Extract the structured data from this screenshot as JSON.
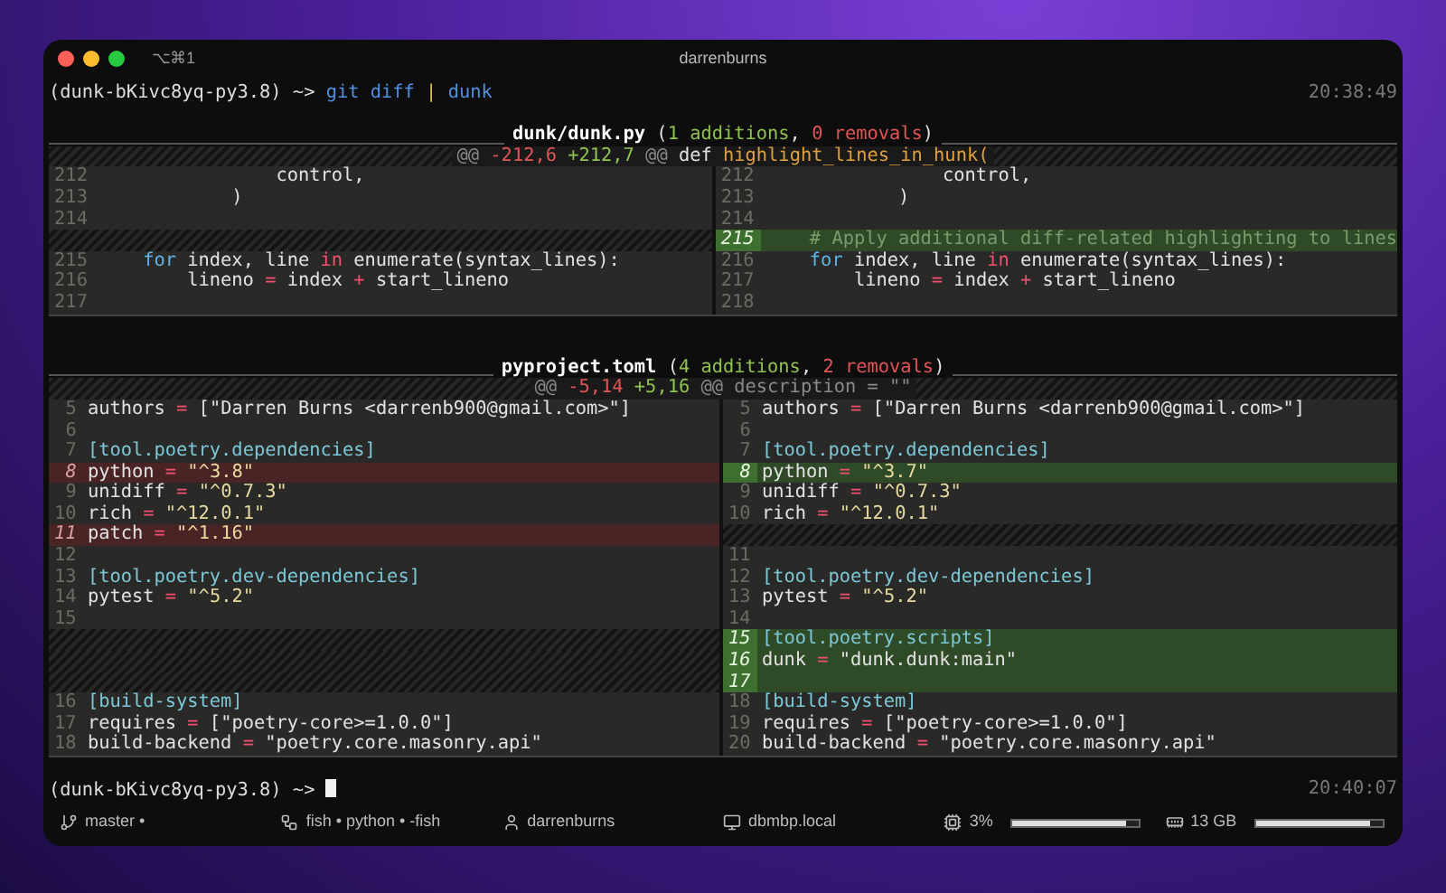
{
  "window": {
    "shortcut": "⌥⌘1",
    "title": "darrenburns"
  },
  "prompt_1": {
    "env": "(dunk-bKivc8yq-py3.8) ~> ",
    "command": [
      {
        "t": "git diff",
        "kind": "cmd"
      },
      {
        "t": " | ",
        "kind": "pipe"
      },
      {
        "t": "dunk",
        "kind": "cmd"
      }
    ],
    "time": "20:38:49"
  },
  "diffs": [
    {
      "header": [
        {
          "t": "dunk/dunk.py",
          "kind": "file"
        },
        {
          "t": " (",
          "kind": "p"
        },
        {
          "t": "1 additions",
          "kind": "add"
        },
        {
          "t": ", ",
          "kind": "p"
        },
        {
          "t": "0 removals",
          "kind": "del"
        },
        {
          "t": ")",
          "kind": "p"
        }
      ],
      "hunk": [
        {
          "t": "@@ ",
          "kind": "dim"
        },
        {
          "t": "-212,6 ",
          "kind": "del"
        },
        {
          "t": "+212,7",
          "kind": "add"
        },
        {
          "t": " @@ ",
          "kind": "dim"
        },
        {
          "t": "def ",
          "kind": "p"
        },
        {
          "t": "highlight_lines_in_hunk(",
          "kind": "fn"
        }
      ],
      "rows": [
        {
          "left": {
            "kind": "context",
            "num": "212",
            "code": [
              {
                "t": "                control,",
                "kind": "p"
              }
            ]
          },
          "right": {
            "kind": "context",
            "num": "212",
            "code": [
              {
                "t": "                control,",
                "kind": "p"
              }
            ]
          }
        },
        {
          "left": {
            "kind": "context",
            "num": "213",
            "code": [
              {
                "t": "            )",
                "kind": "p"
              }
            ]
          },
          "right": {
            "kind": "context",
            "num": "213",
            "code": [
              {
                "t": "            )",
                "kind": "p"
              }
            ]
          }
        },
        {
          "left": {
            "kind": "context",
            "num": "214"
          },
          "right": {
            "kind": "context",
            "num": "214"
          }
        },
        {
          "left": {
            "kind": "filler"
          },
          "right": {
            "kind": "added",
            "num": "215",
            "code": [
              {
                "t": "    # Apply additional diff-related highlighting to lines",
                "kind": "comment"
              }
            ]
          }
        },
        {
          "left": {
            "kind": "context",
            "num": "215",
            "code": [
              {
                "t": "    for",
                "kind": "kw"
              },
              {
                "t": " index, line ",
                "kind": "p"
              },
              {
                "t": "in",
                "kind": "op"
              },
              {
                "t": " enumerate(syntax_lines):",
                "kind": "p"
              }
            ]
          },
          "right": {
            "kind": "context",
            "num": "216",
            "code": [
              {
                "t": "    for",
                "kind": "kw"
              },
              {
                "t": " index, line ",
                "kind": "p"
              },
              {
                "t": "in",
                "kind": "op"
              },
              {
                "t": " enumerate(syntax_lines):",
                "kind": "p"
              }
            ]
          }
        },
        {
          "left": {
            "kind": "context",
            "num": "216",
            "code": [
              {
                "t": "        lineno ",
                "kind": "p"
              },
              {
                "t": "=",
                "kind": "op"
              },
              {
                "t": " index ",
                "kind": "p"
              },
              {
                "t": "+",
                "kind": "op"
              },
              {
                "t": " start_lineno",
                "kind": "p"
              }
            ]
          },
          "right": {
            "kind": "context",
            "num": "217",
            "code": [
              {
                "t": "        lineno ",
                "kind": "p"
              },
              {
                "t": "=",
                "kind": "op"
              },
              {
                "t": " index ",
                "kind": "p"
              },
              {
                "t": "+",
                "kind": "op"
              },
              {
                "t": " start_lineno",
                "kind": "p"
              }
            ]
          }
        },
        {
          "left": {
            "kind": "context",
            "num": "217"
          },
          "right": {
            "kind": "context",
            "num": "218"
          }
        }
      ]
    },
    {
      "header": [
        {
          "t": "pyproject.toml",
          "kind": "file"
        },
        {
          "t": " (",
          "kind": "p"
        },
        {
          "t": "4 additions",
          "kind": "add"
        },
        {
          "t": ", ",
          "kind": "p"
        },
        {
          "t": "2 removals",
          "kind": "del"
        },
        {
          "t": ")",
          "kind": "p"
        }
      ],
      "hunk": [
        {
          "t": "@@ ",
          "kind": "dim"
        },
        {
          "t": "-5,14 ",
          "kind": "del"
        },
        {
          "t": "+5,16",
          "kind": "add"
        },
        {
          "t": " @@ ",
          "kind": "dim"
        },
        {
          "t": "description = \"\"",
          "kind": "dim"
        }
      ],
      "rows": [
        {
          "left": {
            "kind": "context",
            "num": "5",
            "code": [
              {
                "t": "authors ",
                "kind": "p"
              },
              {
                "t": "=",
                "kind": "op"
              },
              {
                "t": " [\"Darren Burns <darrenb900@gmail.com>\"]",
                "kind": "p"
              }
            ]
          },
          "right": {
            "kind": "context",
            "num": "5",
            "code": [
              {
                "t": "authors ",
                "kind": "p"
              },
              {
                "t": "=",
                "kind": "op"
              },
              {
                "t": " [\"Darren Burns <darrenb900@gmail.com>\"]",
                "kind": "p"
              }
            ]
          }
        },
        {
          "left": {
            "kind": "context",
            "num": "6"
          },
          "right": {
            "kind": "context",
            "num": "6"
          }
        },
        {
          "left": {
            "kind": "context",
            "num": "7",
            "code": [
              {
                "t": "[tool.poetry.dependencies]",
                "kind": "section"
              }
            ]
          },
          "right": {
            "kind": "context",
            "num": "7",
            "code": [
              {
                "t": "[tool.poetry.dependencies]",
                "kind": "section"
              }
            ]
          }
        },
        {
          "left": {
            "kind": "removed",
            "num": "8",
            "code": [
              {
                "t": "python ",
                "kind": "p"
              },
              {
                "t": "= ",
                "kind": "op"
              },
              {
                "t": "\"^3.8\"",
                "kind": "str"
              }
            ]
          },
          "right": {
            "kind": "added",
            "num": "8",
            "code": [
              {
                "t": "python ",
                "kind": "p"
              },
              {
                "t": "= ",
                "kind": "op"
              },
              {
                "t": "\"^3.7\"",
                "kind": "str"
              }
            ]
          }
        },
        {
          "left": {
            "kind": "context",
            "num": "9",
            "code": [
              {
                "t": "unidiff ",
                "kind": "p"
              },
              {
                "t": "= ",
                "kind": "op"
              },
              {
                "t": "\"^0.7.3\"",
                "kind": "str"
              }
            ]
          },
          "right": {
            "kind": "context",
            "num": "9",
            "code": [
              {
                "t": "unidiff ",
                "kind": "p"
              },
              {
                "t": "= ",
                "kind": "op"
              },
              {
                "t": "\"^0.7.3\"",
                "kind": "str"
              }
            ]
          }
        },
        {
          "left": {
            "kind": "context",
            "num": "10",
            "code": [
              {
                "t": "rich ",
                "kind": "p"
              },
              {
                "t": "= ",
                "kind": "op"
              },
              {
                "t": "\"^12.0.1\"",
                "kind": "str"
              }
            ]
          },
          "right": {
            "kind": "context",
            "num": "10",
            "code": [
              {
                "t": "rich ",
                "kind": "p"
              },
              {
                "t": "= ",
                "kind": "op"
              },
              {
                "t": "\"^12.0.1\"",
                "kind": "str"
              }
            ]
          }
        },
        {
          "left": {
            "kind": "removed",
            "num": "11",
            "code": [
              {
                "t": "patch ",
                "kind": "p"
              },
              {
                "t": "= ",
                "kind": "op"
              },
              {
                "t": "\"^1.16\"",
                "kind": "str"
              }
            ]
          },
          "right": {
            "kind": "filler"
          }
        },
        {
          "left": {
            "kind": "context",
            "num": "12"
          },
          "right": {
            "kind": "context",
            "num": "11"
          }
        },
        {
          "left": {
            "kind": "context",
            "num": "13",
            "code": [
              {
                "t": "[tool.poetry.dev-dependencies]",
                "kind": "section"
              }
            ]
          },
          "right": {
            "kind": "context",
            "num": "12",
            "code": [
              {
                "t": "[tool.poetry.dev-dependencies]",
                "kind": "section"
              }
            ]
          }
        },
        {
          "left": {
            "kind": "context",
            "num": "14",
            "code": [
              {
                "t": "pytest ",
                "kind": "p"
              },
              {
                "t": "= ",
                "kind": "op"
              },
              {
                "t": "\"^5.2\"",
                "kind": "str"
              }
            ]
          },
          "right": {
            "kind": "context",
            "num": "13",
            "code": [
              {
                "t": "pytest ",
                "kind": "p"
              },
              {
                "t": "= ",
                "kind": "op"
              },
              {
                "t": "\"^5.2\"",
                "kind": "str"
              }
            ]
          }
        },
        {
          "left": {
            "kind": "context",
            "num": "15"
          },
          "right": {
            "kind": "context",
            "num": "14"
          }
        },
        {
          "left": {
            "kind": "filler"
          },
          "right": {
            "kind": "added",
            "num": "15",
            "code": [
              {
                "t": "[tool.poetry.scripts]",
                "kind": "section"
              }
            ]
          }
        },
        {
          "left": {
            "kind": "filler"
          },
          "right": {
            "kind": "added",
            "num": "16",
            "code": [
              {
                "t": "dunk ",
                "kind": "p"
              },
              {
                "t": "=",
                "kind": "op"
              },
              {
                "t": " \"dunk.dunk:main\"",
                "kind": "p"
              }
            ]
          }
        },
        {
          "left": {
            "kind": "filler"
          },
          "right": {
            "kind": "added",
            "num": "17"
          }
        },
        {
          "left": {
            "kind": "context",
            "num": "16",
            "code": [
              {
                "t": "[build-system]",
                "kind": "section"
              }
            ]
          },
          "right": {
            "kind": "context",
            "num": "18",
            "code": [
              {
                "t": "[build-system]",
                "kind": "section"
              }
            ]
          }
        },
        {
          "left": {
            "kind": "context",
            "num": "17",
            "code": [
              {
                "t": "requires ",
                "kind": "p"
              },
              {
                "t": "=",
                "kind": "op"
              },
              {
                "t": " [\"poetry-core>=1.0.0\"]",
                "kind": "p"
              }
            ]
          },
          "right": {
            "kind": "context",
            "num": "19",
            "code": [
              {
                "t": "requires ",
                "kind": "p"
              },
              {
                "t": "=",
                "kind": "op"
              },
              {
                "t": " [\"poetry-core>=1.0.0\"]",
                "kind": "p"
              }
            ]
          }
        },
        {
          "left": {
            "kind": "context",
            "num": "18",
            "code": [
              {
                "t": "build-backend ",
                "kind": "p"
              },
              {
                "t": "=",
                "kind": "op"
              },
              {
                "t": " \"poetry.core.masonry.api\"",
                "kind": "p"
              }
            ]
          },
          "right": {
            "kind": "context",
            "num": "20",
            "code": [
              {
                "t": "build-backend ",
                "kind": "p"
              },
              {
                "t": "=",
                "kind": "op"
              },
              {
                "t": " \"poetry.core.masonry.api\"",
                "kind": "p"
              }
            ]
          }
        }
      ]
    }
  ],
  "prompt_2": {
    "env": "(dunk-bKivc8yq-py3.8) ~> ",
    "time": "20:40:07"
  },
  "status_bar": [
    {
      "kind": "branch",
      "text": "master •"
    },
    {
      "kind": "process",
      "text": "fish • python • -fish"
    },
    {
      "kind": "user",
      "text": "darrenburns"
    },
    {
      "kind": "host",
      "text": "dbmbp.local"
    },
    {
      "kind": "cpu",
      "text": "3%",
      "level": 0.9
    },
    {
      "kind": "memory",
      "text": "13 GB",
      "level": 0.9
    }
  ]
}
